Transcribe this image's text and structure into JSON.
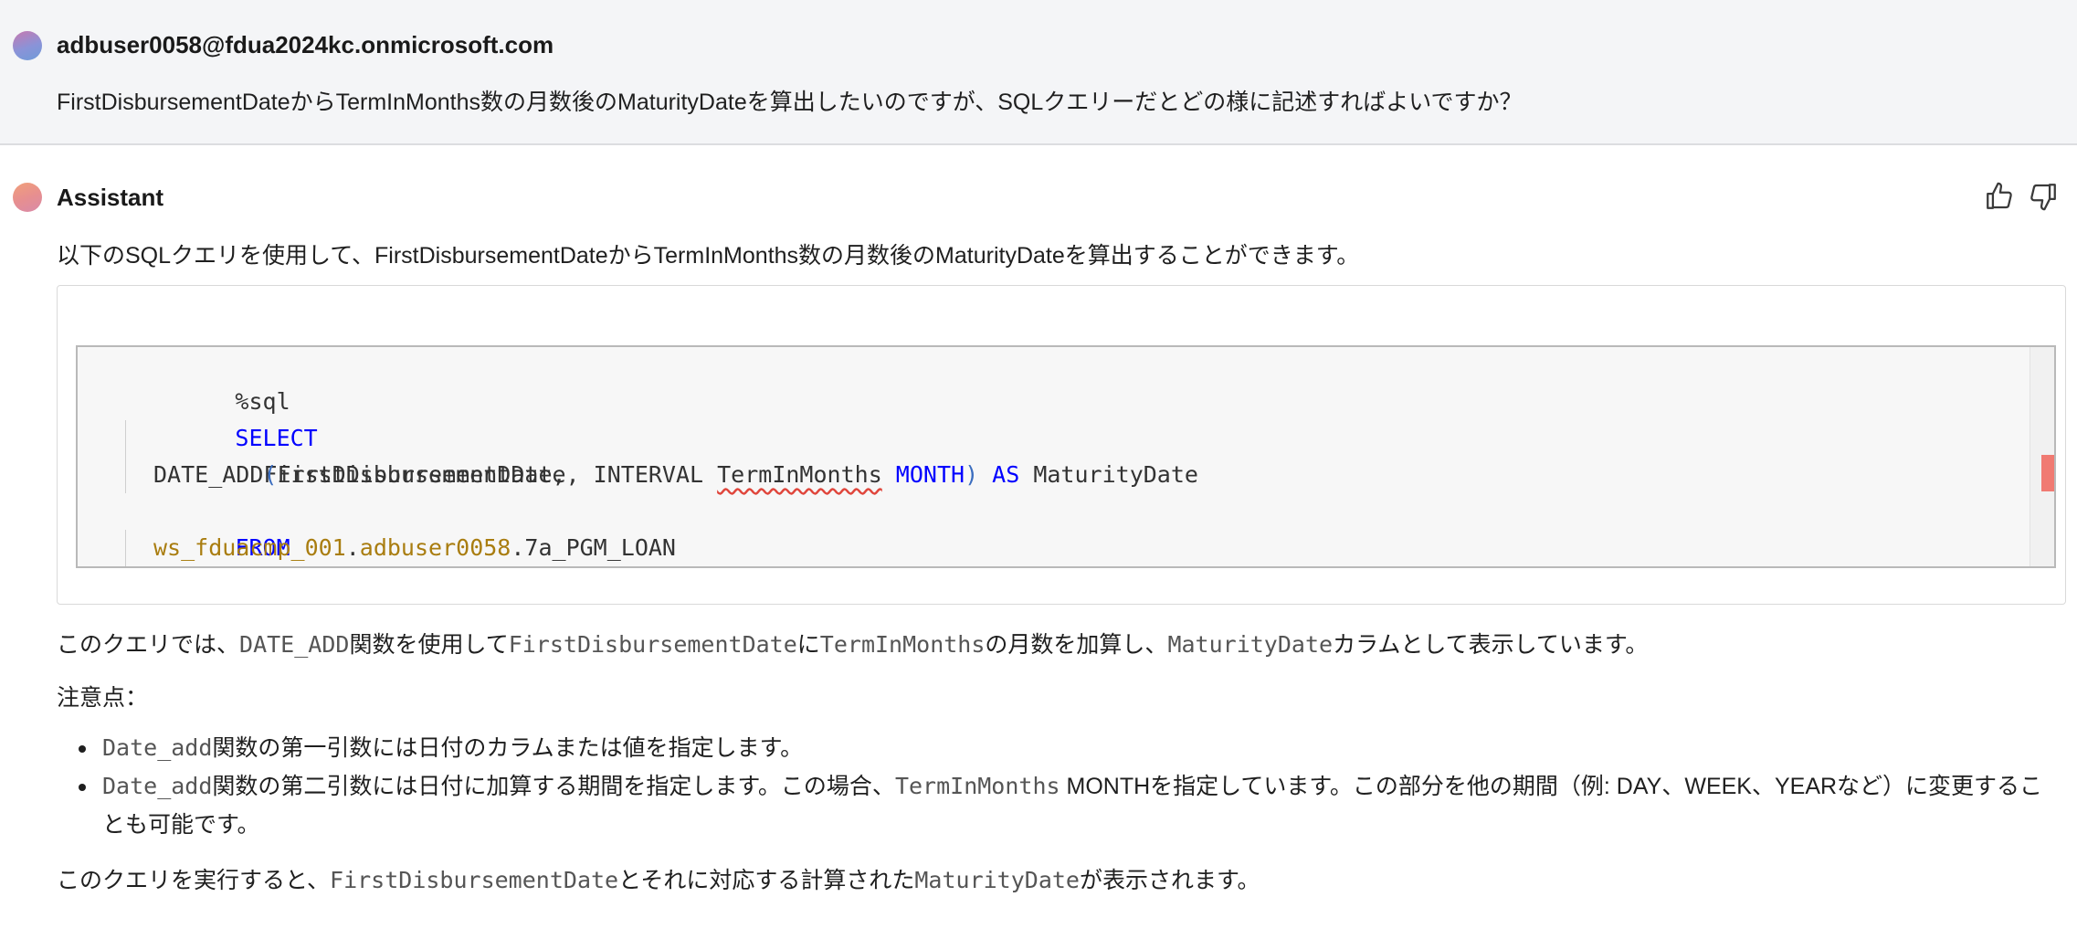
{
  "user": {
    "email": "adbuser0058@fdua2024kc.onmicrosoft.com",
    "message": "FirstDisbursementDateからTermInMonths数の月数後のMaturityDateを算出したいのですが、SQLクエリーだとどの様に記述すればよいですか？"
  },
  "assistant": {
    "name": "Assistant",
    "intro": "以下のSQLクエリを使用して、FirstDisbursementDateからTermInMonths数の月数後のMaturityDateを算出することができます。",
    "feedback": {
      "like_icon": "thumbs-up-icon",
      "dislike_icon": "thumbs-down-icon"
    },
    "code": {
      "line1": "%sql",
      "line2_kw": "SELECT",
      "line3": "FirstDisbursementDate,",
      "line4_fn": "DATE_ADD",
      "line4_paren_open": "(",
      "line4_arg": "FirstDisbursementDate, INTERVAL ",
      "line4_term": "TermInMonths",
      "line4_month": " MONTH",
      "line4_paren_close": ")",
      "line4_as": " AS",
      "line4_alias": " MaturityDate",
      "line5_kw": "FROM",
      "line6_schema1": "ws_fduacmp_001",
      "line6_dot1": ".",
      "line6_schema2": "adbuser0058",
      "line6_table": ".7a_PGM_LOAN"
    },
    "explanation": {
      "t1": "このクエリでは、",
      "c1": "DATE_ADD",
      "t2": "関数を使用して",
      "c2": "FirstDisbursementDate",
      "t3": "に",
      "c3": "TermInMonths",
      "t4": "の月数を加算し、",
      "c4": "MaturityDate",
      "t5": "カラムとして表示しています。"
    },
    "notes_label": "注意点：",
    "bullets": [
      {
        "code": "Date_add",
        "text": "関数の第一引数には日付のカラムまたは値を指定します。"
      },
      {
        "code": "Date_add",
        "text_a": "関数の第二引数には日付に加算する期間を指定します。この場合、",
        "code2": "TermInMonths",
        "text_b": " MONTHを指定しています。この部分を他の期間（例: DAY、WEEK、YEARなど）に変更することも可能です。"
      }
    ],
    "closing": {
      "t1": "このクエリを実行すると、",
      "c1": "FirstDisbursementDate",
      "t2": "とそれに対応する計算された",
      "c2": "MaturityDate",
      "t3": "が表示されます。"
    }
  }
}
